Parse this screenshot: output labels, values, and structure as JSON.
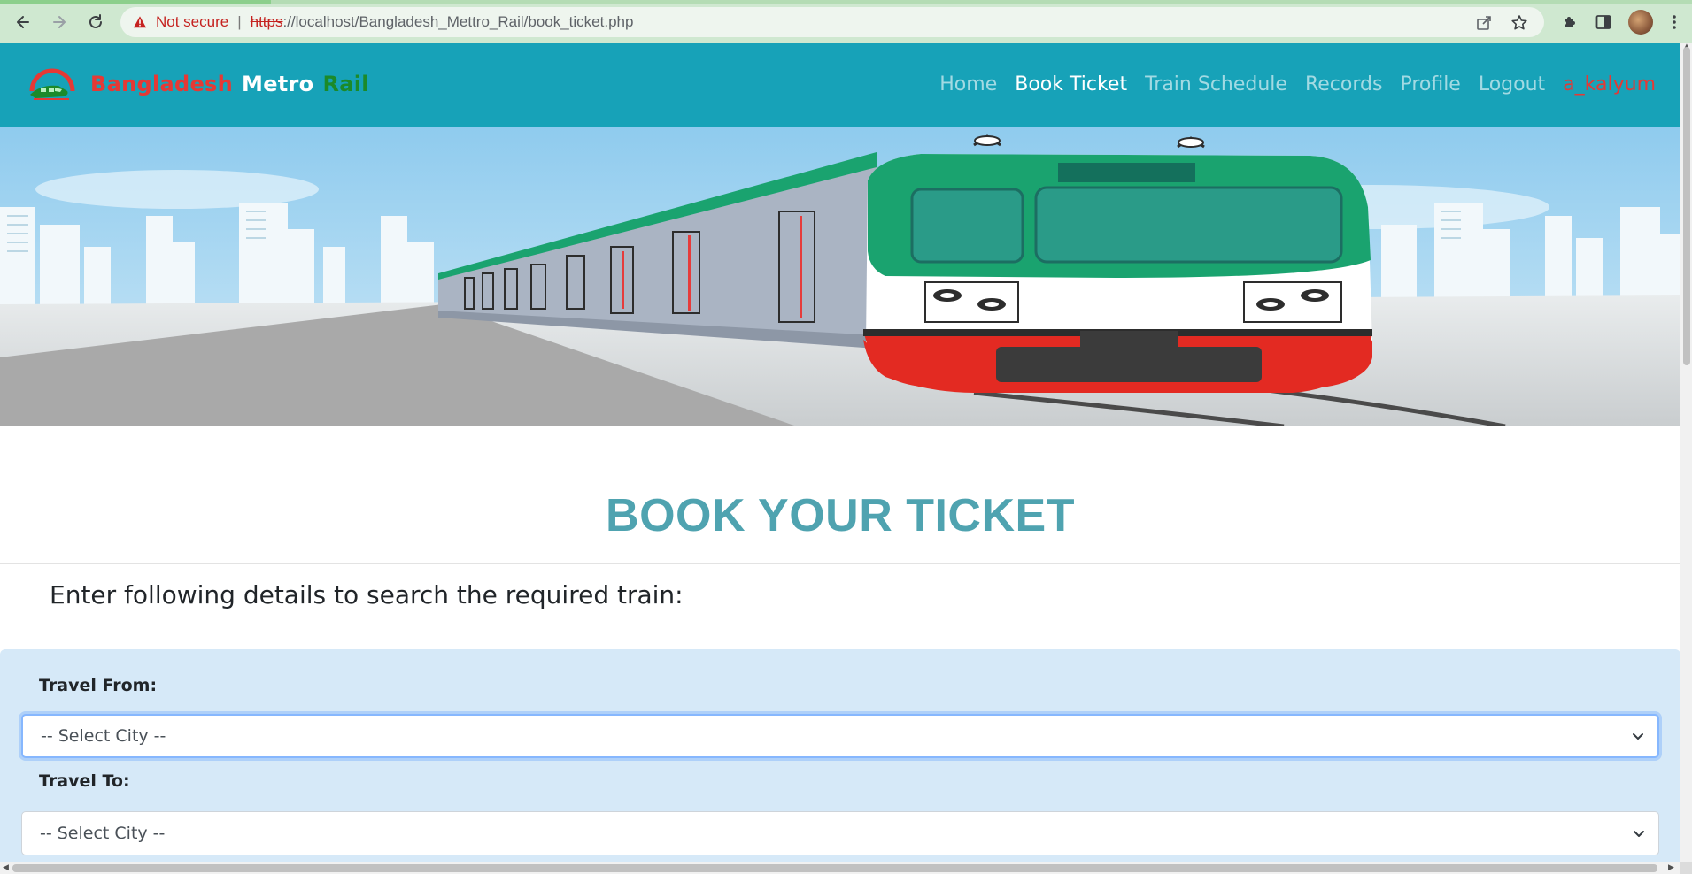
{
  "browser": {
    "security_label": "Not secure",
    "url_scheme": "https",
    "url_rest": "://localhost/Bangladesh_Mettro_Rail/book_ticket.php"
  },
  "navbar": {
    "brand": {
      "word1": "Bangladesh",
      "word2": "Metro",
      "word3": "Rail"
    },
    "links": {
      "home": "Home",
      "book_ticket": "Book Ticket",
      "train_schedule": "Train Schedule",
      "records": "Records",
      "profile": "Profile",
      "logout": "Logout"
    },
    "username": "a_kalyum"
  },
  "main": {
    "title": "BOOK YOUR TICKET",
    "subtitle": "Enter following details to search the required train:"
  },
  "form": {
    "travel_from": {
      "label": "Travel From:",
      "selected": "-- Select City --"
    },
    "travel_to": {
      "label": "Travel To:",
      "selected": "-- Select City --"
    }
  },
  "colors": {
    "navbar_bg": "#17a2b8",
    "brand_red": "#e53935",
    "brand_green": "#1b8a2a",
    "title_color": "#4fa3b0",
    "form_panel_bg": "#d6e9f8"
  }
}
